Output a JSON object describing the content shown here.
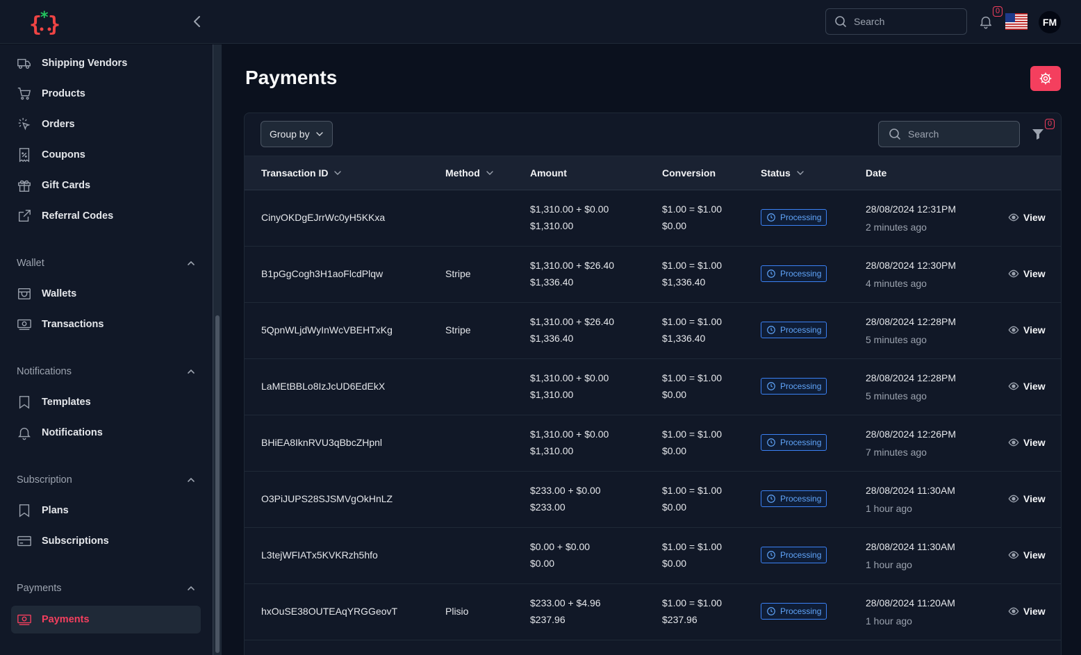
{
  "header": {
    "search_placeholder": "Search",
    "notification_count": "0",
    "user_initials": "FM"
  },
  "sidebar": {
    "top_items": [
      {
        "label": "Shipping Vendors",
        "icon": "truck-icon"
      },
      {
        "label": "Products",
        "icon": "cart-icon"
      },
      {
        "label": "Orders",
        "icon": "cursor-click-icon"
      },
      {
        "label": "Coupons",
        "icon": "receipt-percent-icon"
      },
      {
        "label": "Gift Cards",
        "icon": "gift-icon"
      },
      {
        "label": "Referral Codes",
        "icon": "external-link-icon"
      }
    ],
    "sections": [
      {
        "label": "Wallet",
        "items": [
          {
            "label": "Wallets",
            "icon": "wallet-icon"
          },
          {
            "label": "Transactions",
            "icon": "cash-icon"
          }
        ]
      },
      {
        "label": "Notifications",
        "items": [
          {
            "label": "Templates",
            "icon": "bookmark-icon"
          },
          {
            "label": "Notifications",
            "icon": "bell-icon"
          }
        ]
      },
      {
        "label": "Subscription",
        "items": [
          {
            "label": "Plans",
            "icon": "bookmark-icon"
          },
          {
            "label": "Subscriptions",
            "icon": "credit-card-icon"
          }
        ]
      },
      {
        "label": "Payments",
        "items": [
          {
            "label": "Payments",
            "icon": "cash-icon",
            "active": true
          }
        ]
      }
    ]
  },
  "main": {
    "title": "Payments",
    "toolbar": {
      "group_by_label": "Group by",
      "search_placeholder": "Search",
      "filter_count": "0"
    },
    "columns": [
      "Transaction ID",
      "Method",
      "Amount",
      "Conversion",
      "Status",
      "Date"
    ],
    "view_label": "View",
    "rows": [
      {
        "id": "CinyOKDgEJrrWc0yH5KKxa",
        "method": "",
        "amount": "$1,310.00 + $0.00",
        "amount_total": "$1,310.00",
        "conversion": "$1.00 = $1.00",
        "conversion_total": "$0.00",
        "status": "Processing",
        "date": "28/08/2024 12:31PM",
        "ago": "2 minutes ago"
      },
      {
        "id": "B1pGgCogh3H1aoFlcdPlqw",
        "method": "Stripe",
        "amount": "$1,310.00 + $26.40",
        "amount_total": "$1,336.40",
        "conversion": "$1.00 = $1.00",
        "conversion_total": "$1,336.40",
        "status": "Processing",
        "date": "28/08/2024 12:30PM",
        "ago": "4 minutes ago"
      },
      {
        "id": "5QpnWLjdWyInWcVBEHTxKg",
        "method": "Stripe",
        "amount": "$1,310.00 + $26.40",
        "amount_total": "$1,336.40",
        "conversion": "$1.00 = $1.00",
        "conversion_total": "$1,336.40",
        "status": "Processing",
        "date": "28/08/2024 12:28PM",
        "ago": "5 minutes ago"
      },
      {
        "id": "LaMEtBBLo8IzJcUD6EdEkX",
        "method": "",
        "amount": "$1,310.00 + $0.00",
        "amount_total": "$1,310.00",
        "conversion": "$1.00 = $1.00",
        "conversion_total": "$0.00",
        "status": "Processing",
        "date": "28/08/2024 12:28PM",
        "ago": "5 minutes ago"
      },
      {
        "id": "BHiEA8IknRVU3qBbcZHpnl",
        "method": "",
        "amount": "$1,310.00 + $0.00",
        "amount_total": "$1,310.00",
        "conversion": "$1.00 = $1.00",
        "conversion_total": "$0.00",
        "status": "Processing",
        "date": "28/08/2024 12:26PM",
        "ago": "7 minutes ago"
      },
      {
        "id": "O3PiJUPS28SJSMVgOkHnLZ",
        "method": "",
        "amount": "$233.00 + $0.00",
        "amount_total": "$233.00",
        "conversion": "$1.00 = $1.00",
        "conversion_total": "$0.00",
        "status": "Processing",
        "date": "28/08/2024 11:30AM",
        "ago": "1 hour ago"
      },
      {
        "id": "L3tejWFIATx5KVKRzh5hfo",
        "method": "",
        "amount": "$0.00 + $0.00",
        "amount_total": "$0.00",
        "conversion": "$1.00 = $1.00",
        "conversion_total": "$0.00",
        "status": "Processing",
        "date": "28/08/2024 11:30AM",
        "ago": "1 hour ago"
      },
      {
        "id": "hxOuSE38OUTEAqYRGGeovT",
        "method": "Plisio",
        "amount": "$233.00 + $4.96",
        "amount_total": "$237.96",
        "conversion": "$1.00 = $1.00",
        "conversion_total": "$237.96",
        "status": "Processing",
        "date": "28/08/2024 11:20AM",
        "ago": "1 hour ago"
      }
    ]
  },
  "colors": {
    "accent": "#f43f5e",
    "status_blue": "#3b82f6",
    "background": "#0b111e",
    "panel": "#111827"
  }
}
